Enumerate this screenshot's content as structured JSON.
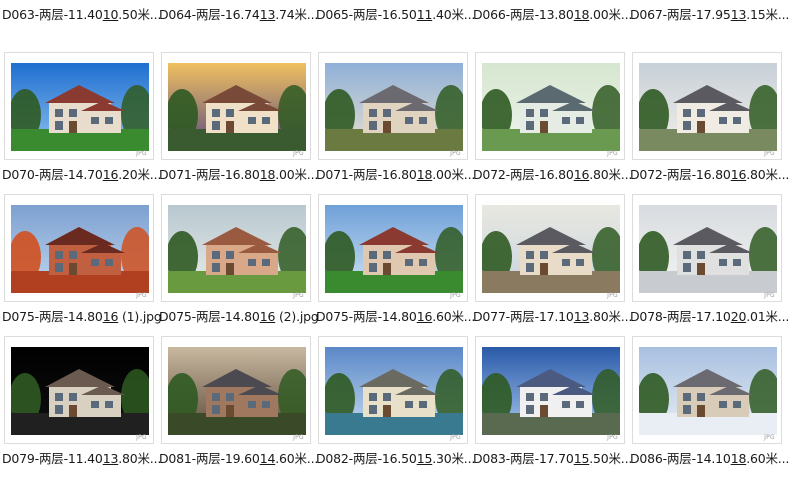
{
  "badge_text": "JPG",
  "files": [
    {
      "name": "D063-两层-11.40",
      "ul": "10",
      ".50米...": ".50米...",
      "tail": ".50米..."
    },
    {
      "name": "D064-两层-16.74",
      "ul": "13",
      "tail": ".74米..."
    },
    {
      "name": "D065-两层-16.50",
      "ul": "11",
      "tail": ".40米..."
    },
    {
      "name": "D066-两层-13.80",
      "ul": "18",
      "tail": ".00米..."
    },
    {
      "name": "D067-两层-17.95",
      "ul": "13",
      "tail": ".15米..."
    },
    {
      "name": "D070-两层-14.70",
      "ul": "16",
      "tail": ".20米..."
    },
    {
      "name": "D071-两层-16.80",
      "ul": "18",
      "tail": ".00米..."
    },
    {
      "name": "D071-两层-16.80",
      "ul": "18",
      "tail": ".00米..."
    },
    {
      "name": "D072-两层-16.80",
      "ul": "16",
      "tail": ".80米..."
    },
    {
      "name": "D072-两层-16.80",
      "ul": "16",
      "tail": ".80米..."
    },
    {
      "name": "D075-两层-14.80",
      "ul": "16",
      "tail": " (1).jpg"
    },
    {
      "name": "D075-两层-14.80",
      "ul": "16",
      "tail": " (2).jpg"
    },
    {
      "name": "D075-两层-14.80",
      "ul": "16",
      "tail": ".60米..."
    },
    {
      "name": "D077-两层-17.10",
      "ul": "13",
      "tail": ".80米..."
    },
    {
      "name": "D078-两层-17.10",
      "ul": "20",
      "tail": ".01米..."
    },
    {
      "name": "D079-两层-11.40",
      "ul": "13",
      "tail": ".80米..."
    },
    {
      "name": "D081-两层-19.60",
      "ul": "14",
      "tail": ".60米..."
    },
    {
      "name": "D082-两层-16.50",
      "ul": "15",
      "tail": ".30米..."
    },
    {
      "name": "D083-两层-17.70",
      "ul": "15",
      "tail": ".50米..."
    },
    {
      "name": "D086-两层-14.10",
      "ul": "18",
      "tail": ".60米..."
    }
  ]
}
